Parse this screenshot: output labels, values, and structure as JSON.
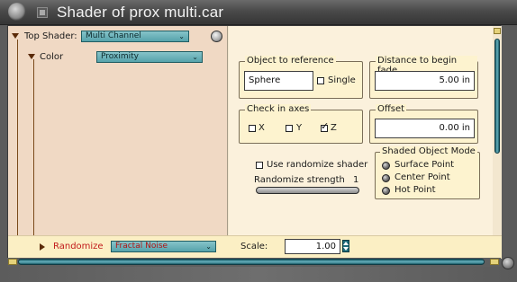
{
  "window": {
    "title": "Shader of prox multi.car"
  },
  "tree": {
    "top_shader_label": "Top Shader:",
    "top_shader_value": "Multi Channel",
    "color_label": "Color",
    "color_value": "Proximity",
    "randomize_label": "Randomize",
    "randomize_value": "Fractal Noise"
  },
  "object_ref": {
    "title": "Object to reference",
    "value": "Sphere",
    "single_label": "Single",
    "single_checked": false
  },
  "distance": {
    "title": "Distance to begin fade",
    "value": "5.00 in"
  },
  "axes": {
    "title": "Check in axes",
    "x_label": "X",
    "y_label": "Y",
    "z_label": "Z",
    "x_checked": false,
    "y_checked": false,
    "z_checked": true
  },
  "offset": {
    "title": "Offset",
    "value": "0.00 in"
  },
  "randomize": {
    "use_label": "Use randomize shader",
    "use_checked": false,
    "strength_label": "Randomize strength",
    "strength_value": "1"
  },
  "shaded_mode": {
    "title": "Shaded Object Mode",
    "options": [
      "Surface Point",
      "Center Point",
      "Hot Point"
    ]
  },
  "scale": {
    "label": "Scale:",
    "value": "1.00"
  },
  "colors": {
    "accent_teal": "#56a3ab",
    "pane_left": "#f0d9c4",
    "pane_right": "#fbf1dc",
    "label_red": "#c21b1b"
  },
  "icons": {
    "trash": "trash-icon",
    "window_menu": "window-menu-icon",
    "window_collapse": "collapse-icon"
  }
}
